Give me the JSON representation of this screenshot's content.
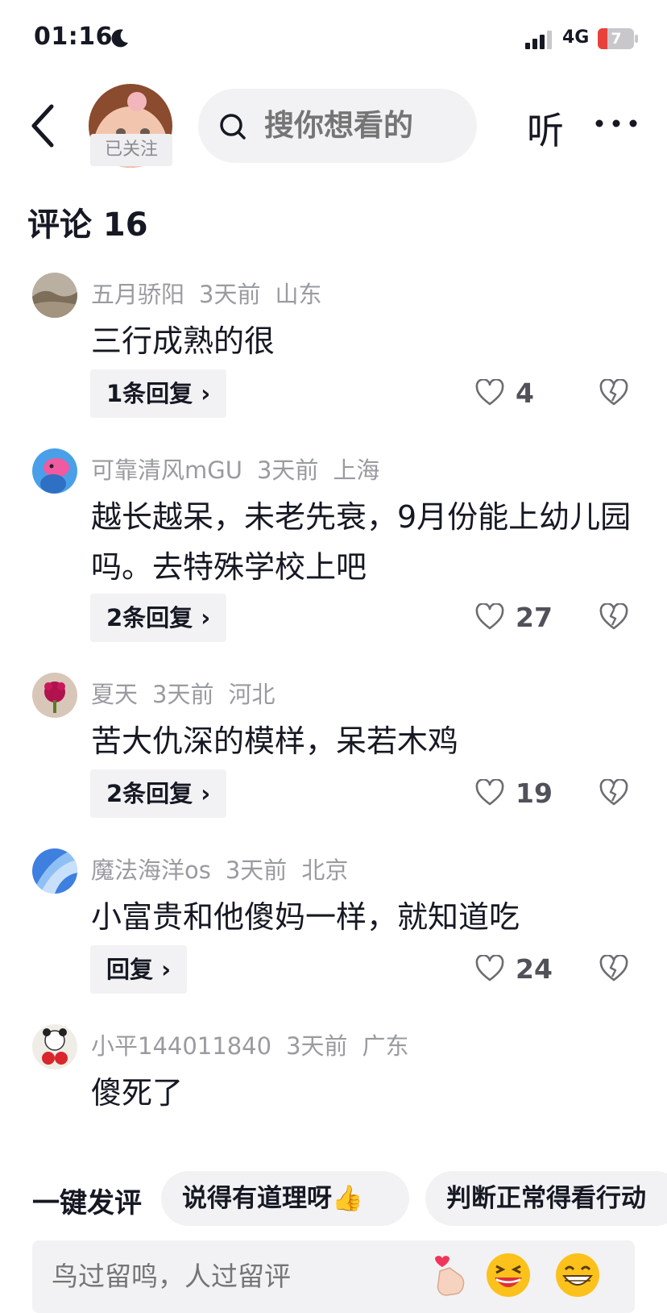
{
  "status_bar": {
    "time": "01:16",
    "network": "4G",
    "battery": "7"
  },
  "header": {
    "follow_badge": "已关注",
    "search_placeholder": "搜你想看的",
    "listen_label": "听"
  },
  "comments_title": "评论 16",
  "comments": [
    {
      "user": "五月骄阳",
      "time": "3天前",
      "location": "山东",
      "text": "三行成熟的很",
      "replies": "1条回复 ›",
      "likes": "4"
    },
    {
      "user": "可靠清风mGU",
      "time": "3天前",
      "location": "上海",
      "text": "越长越呆，未老先衰，9月份能上幼儿园吗。去特殊学校上吧",
      "replies": "2条回复 ›",
      "likes": "27"
    },
    {
      "user": "夏天",
      "time": "3天前",
      "location": "河北",
      "text": "苦大仇深的模样，呆若木鸡",
      "replies": "2条回复 ›",
      "likes": "19"
    },
    {
      "user": "魔法海洋os",
      "time": "3天前",
      "location": "北京",
      "text": "小富贵和他傻妈一样，就知道吃",
      "replies": "回复 ›",
      "likes": "24"
    },
    {
      "user": "小平144011840",
      "time": "3天前",
      "location": "广东",
      "text": "傻死了"
    }
  ],
  "quick_comment": {
    "label": "一键发评",
    "chips": [
      "说得有道理呀👍",
      "判断正常得看行动"
    ]
  },
  "input": {
    "placeholder": "鸟过留鸣，人过留评"
  },
  "icons": [
    "back-icon",
    "search-icon",
    "more-icon",
    "heart-icon",
    "dislike-icon",
    "moon-icon",
    "signal-icon",
    "battery-icon"
  ],
  "colors": {
    "text": "#161823",
    "secondary": "#9a9ba0",
    "chip_bg": "#f2f2f4",
    "battery_low": "#e8413c"
  }
}
